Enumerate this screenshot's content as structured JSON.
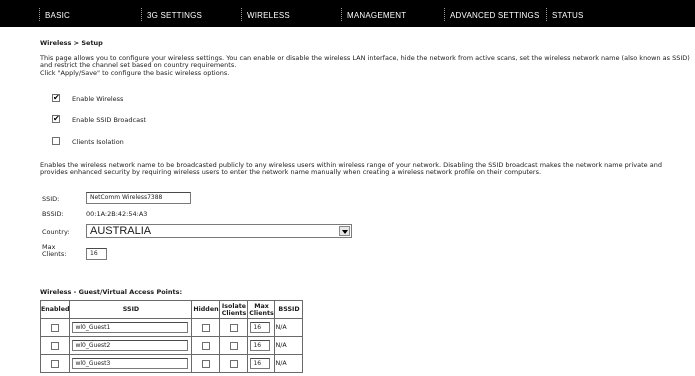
{
  "nav": {
    "items": [
      "BASIC",
      "3G SETTINGS",
      "WIRELESS",
      "MANAGEMENT",
      "ADVANCED SETTINGS",
      "STATUS"
    ]
  },
  "page": {
    "title": "Wireless > Setup",
    "intro": "This page allows you to configure your wireless settings. You can enable or disable the wireless LAN interface, hide the network from active scans, set the wireless network name (also known as SSID) and restrict the channel set based on country requirements.\nClick \"Apply/Save\" to configure the basic wireless options."
  },
  "options": [
    {
      "label": "Enable Wireless",
      "checked": true
    },
    {
      "label": "Enable SSID Broadcast",
      "checked": true
    },
    {
      "label": "Clients Isolation",
      "checked": false
    }
  ],
  "ssid_note": "Enables the wireless network name to be broadcasted publicly to any wireless users within wireless range of your network. Disabling the SSID broadcast makes the network name private and provides enhanced security by requiring wireless users to enter the network name manually when creating a wireless network profile on their computers.",
  "form": {
    "ssid_label": "SSID:",
    "ssid_value": "NetComm Wireless7388",
    "bssid_label": "BSSID:",
    "bssid_value": "00:1A:2B:42:54:A3",
    "country_label": "Country:",
    "country_value": "AUSTRALIA",
    "max_clients_label": "Max Clients:",
    "max_clients_value": "16"
  },
  "guest": {
    "title": "Wireless - Guest/Virtual Access Points:",
    "headers": [
      "Enabled",
      "SSID",
      "Hidden",
      "Isolate Clients",
      "Max Clients",
      "BSSID"
    ],
    "rows": [
      {
        "enabled": false,
        "ssid": "wl0_Guest1",
        "hidden": false,
        "isolate": false,
        "max": "16",
        "bssid": "N/A"
      },
      {
        "enabled": false,
        "ssid": "wl0_Guest2",
        "hidden": false,
        "isolate": false,
        "max": "16",
        "bssid": "N/A"
      },
      {
        "enabled": false,
        "ssid": "wl0_Guest3",
        "hidden": false,
        "isolate": false,
        "max": "16",
        "bssid": "N/A"
      }
    ]
  }
}
